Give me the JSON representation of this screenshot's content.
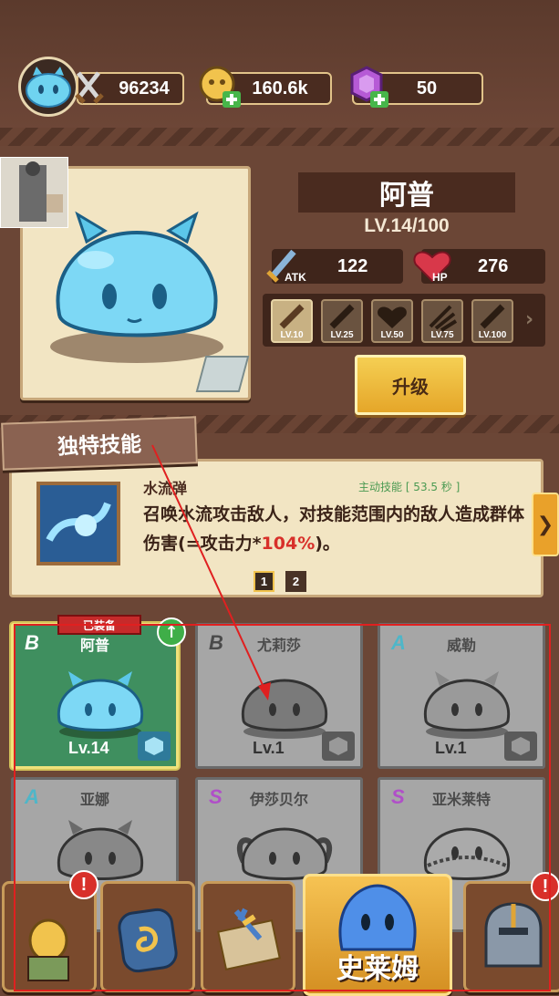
{
  "colors": {
    "annotation_red": "#e02020",
    "gold": "#f1c34d",
    "brown": "#6b4636"
  },
  "resources": {
    "attack_power": "96234",
    "gold": "160.6k",
    "gems": "50"
  },
  "hero": {
    "name": "阿普",
    "level": "LV.14/100",
    "atk_label": "ATK",
    "atk_value": "122",
    "hp_label": "HP",
    "hp_value": "276",
    "milestones": [
      {
        "label": "LV.10",
        "icon": "sword-icon",
        "unlocked": true
      },
      {
        "label": "LV.25",
        "icon": "sword-icon",
        "unlocked": false
      },
      {
        "label": "LV.50",
        "icon": "heart-icon",
        "unlocked": false
      },
      {
        "label": "LV.75",
        "icon": "claw-icon",
        "unlocked": false
      },
      {
        "label": "LV.100",
        "icon": "sword-icon",
        "unlocked": false
      }
    ],
    "upgrade_label": "升级"
  },
  "skill": {
    "banner": "独特技能",
    "name": "水流弹",
    "type": "主动技能 [ 53.5 秒 ]",
    "desc_part1": "召唤水流攻击敌人，对技能范围内的敌人造成群体伤害(=攻击力*",
    "desc_highlight": "104%",
    "desc_part2": ")。",
    "pages": [
      "1",
      "2"
    ],
    "current_page": "1"
  },
  "equipped_tag": "已装备",
  "cards": [
    {
      "rank": "B",
      "name": "阿普",
      "level": "Lv.14",
      "owned": true,
      "rank_color": "#ffffff"
    },
    {
      "rank": "B",
      "name": "尤莉莎",
      "level": "Lv.1",
      "owned": false,
      "rank_color": "#4a4a4a"
    },
    {
      "rank": "A",
      "name": "威勒",
      "level": "Lv.1",
      "owned": false,
      "rank_color": "#4fb6c8"
    },
    {
      "rank": "A",
      "name": "亚娜",
      "level": "",
      "owned": false,
      "rank_color": "#4fb6c8"
    },
    {
      "rank": "S",
      "name": "伊莎贝尔",
      "level": "",
      "owned": false,
      "rank_color": "#b04fc8"
    },
    {
      "rank": "S",
      "name": "亚米莱特",
      "level": "",
      "owned": false,
      "rank_color": "#b04fc8"
    }
  ],
  "nav": {
    "active_label": "史莱姆"
  }
}
